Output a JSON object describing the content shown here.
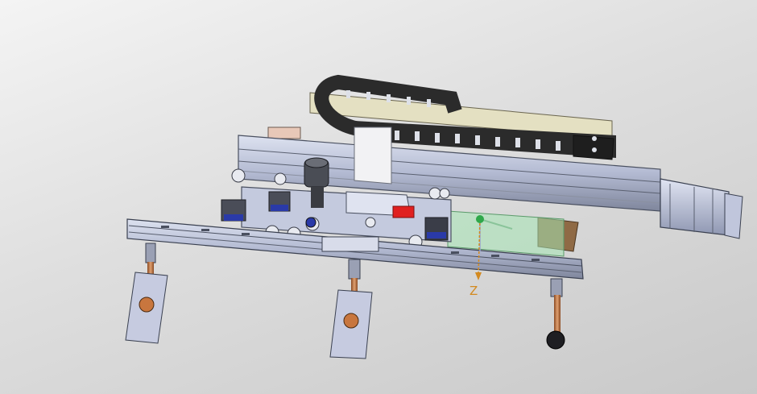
{
  "viewport": {
    "background_top": "#f4f4f4",
    "background_bottom": "#c9c9c9",
    "model_name": "cable-carrier-linear-gantry-with-suction-pads"
  },
  "triad": {
    "z_label": "Z",
    "z_color": "#d38a20",
    "origin_color": "#2fa84a",
    "plane_color": "#9be0b0"
  },
  "colors": {
    "rail": "#b8c0d8",
    "rail_dark": "#5a6070",
    "chain": "#2b2b2b",
    "motor": "#b5bdd8",
    "rod": "#c8763e",
    "pad": "#c6cbe0",
    "accent_red": "#e02020",
    "accent_blue": "#2a3aa8",
    "wood": "#a07850"
  }
}
